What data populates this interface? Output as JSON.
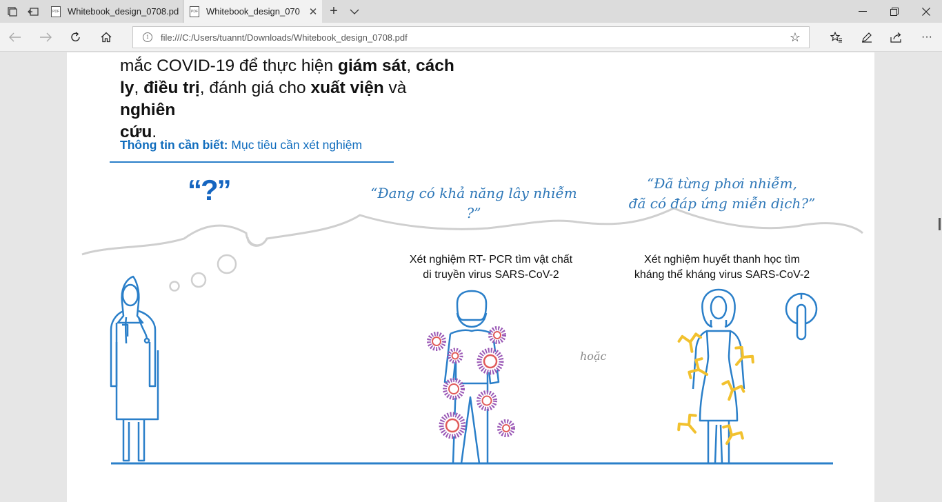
{
  "browser": {
    "tabs": [
      {
        "title": "Whitebook_design_0708.pd",
        "active": false
      },
      {
        "title": "Whitebook_design_070",
        "active": true
      }
    ],
    "address_url": "file:///C:/Users/tuannt/Downloads/Whitebook_design_0708.pdf",
    "icons": [
      "tab-set-aside-icon",
      "tab-preview-icon",
      "back-icon",
      "forward-icon",
      "refresh-icon",
      "home-icon",
      "favorites-star-icon",
      "favorites-list-icon",
      "notes-icon",
      "share-icon",
      "more-icon",
      "minimize-icon",
      "restore-icon",
      "close-icon"
    ]
  },
  "document": {
    "para_line1_start": "mắc COVID-19 để thực hiện ",
    "para_line1_bold1": "giám sát",
    "para_line1_mid": ", ",
    "para_line1_bold2": "cách",
    "para_line2_bold1": "ly",
    "para_line2_mid1": ", ",
    "para_line2_bold2": "điều trị",
    "para_line2_mid2": ", đánh giá cho ",
    "para_line2_bold3": "xuất viện",
    "para_line2_mid3": " và ",
    "para_line2_bold4": "nghiên",
    "para_line3_bold": "cứu",
    "para_line3_end": ".",
    "info_label": "Thông tin cần biết:",
    "info_text": " Mục tiêu cần xét nghiệm",
    "question_mark": "“?”",
    "quote_infectious": "“Đang có khả năng lây nhiễm ?”",
    "quote_exposed_line1": "“Đã từng phơi nhiễm,",
    "quote_exposed_line2": "đã có đáp ứng miễn dịch?”",
    "pcr_caption_line1": "Xét nghiệm RT- PCR tìm vật chất",
    "pcr_caption_line2": "di truyền virus SARS-CoV-2",
    "sero_caption_line1": "Xét nghiệm huyết thanh học tìm",
    "sero_caption_line2": "kháng thể  kháng virus SARS-CoV-2",
    "or_label": "hoặc"
  },
  "colors": {
    "figure_blue": "#2a7fc9",
    "virus_purple": "#9b59b6",
    "virus_red": "#e05a5a",
    "antibody_yellow": "#f2c12e",
    "cloud_gray": "#cfcfcf"
  }
}
